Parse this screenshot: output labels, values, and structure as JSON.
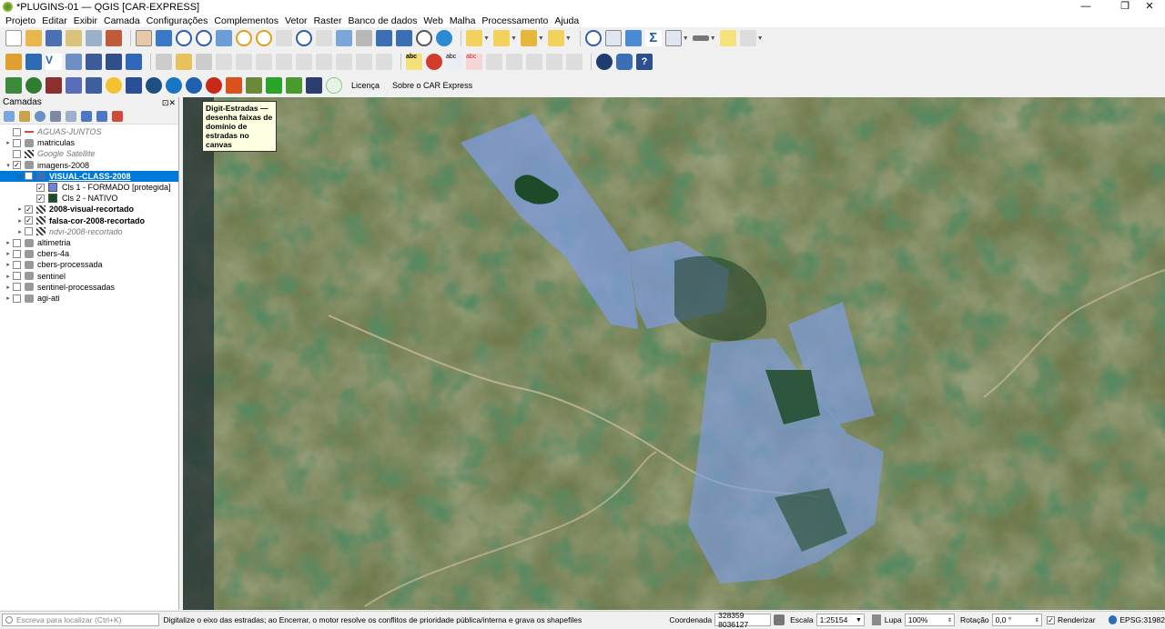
{
  "window": {
    "title": "*PLUGINS-01 — QGIS [CAR-EXPRESS]",
    "minimize": "—",
    "maximize": "❐",
    "close": "✕"
  },
  "menu": [
    "Projeto",
    "Editar",
    "Exibir",
    "Camada",
    "Configurações",
    "Complementos",
    "Vetor",
    "Raster",
    "Banco de dados",
    "Web",
    "Malha",
    "Processamento",
    "Ajuda"
  ],
  "plugins_toolbar": {
    "licenca": "Licença",
    "sobre": "Sobre o CAR Express"
  },
  "tooltip": "Digit-Estradas — desenha faixas de domínio de estradas no canvas",
  "layers_panel": {
    "title": "Camadas",
    "layers": [
      {
        "name": "AGUAS-JUNTOS",
        "checked": false,
        "style": "italic-gray"
      },
      {
        "name": "matriculas",
        "checked": false,
        "style": "normal"
      },
      {
        "name": "Google Satellite",
        "checked": false,
        "style": "italic-gray"
      },
      {
        "name": "imagens-2008",
        "checked": true,
        "style": "normal"
      },
      {
        "name": "VISUAL-CLASS-2008",
        "checked": true,
        "style": "selected"
      },
      {
        "name": "Cls 1 - FORMADO [protegida]",
        "checked": true,
        "style": "normal",
        "color": "#6b86d6"
      },
      {
        "name": "Cls 2 - NATIVO",
        "checked": true,
        "style": "normal",
        "color": "#14502a"
      },
      {
        "name": "2008-visual-recortado",
        "checked": true,
        "style": "bold"
      },
      {
        "name": "falsa-cor-2008-recortado",
        "checked": true,
        "style": "bold"
      },
      {
        "name": "ndvi-2008-recortado",
        "checked": false,
        "style": "italic-gray"
      },
      {
        "name": "altimetria",
        "checked": false,
        "style": "normal"
      },
      {
        "name": "cbers-4a",
        "checked": false,
        "style": "normal"
      },
      {
        "name": "cbers-processada",
        "checked": false,
        "style": "normal"
      },
      {
        "name": "sentinel",
        "checked": false,
        "style": "normal"
      },
      {
        "name": "sentinel-processadas",
        "checked": false,
        "style": "normal"
      },
      {
        "name": "agi-ati",
        "checked": false,
        "style": "normal"
      }
    ]
  },
  "status": {
    "locator_placeholder": "Escreva para localizar (Ctrl+K)",
    "message": "Digitalize o eixo das estradas; ao Encerrar, o motor resolve os conflitos de prioridade pública/interna e grava os shapefiles",
    "coord_label": "Coordenada",
    "coord_value": "328359  8036127",
    "scale_label": "Escala",
    "scale_value": "1:25154",
    "magnifier_label": "Lupa",
    "magnifier_value": "100%",
    "rotation_label": "Rotação",
    "rotation_value": "0,0 °",
    "render_label": "Renderizar",
    "crs": "EPSG:31982"
  }
}
